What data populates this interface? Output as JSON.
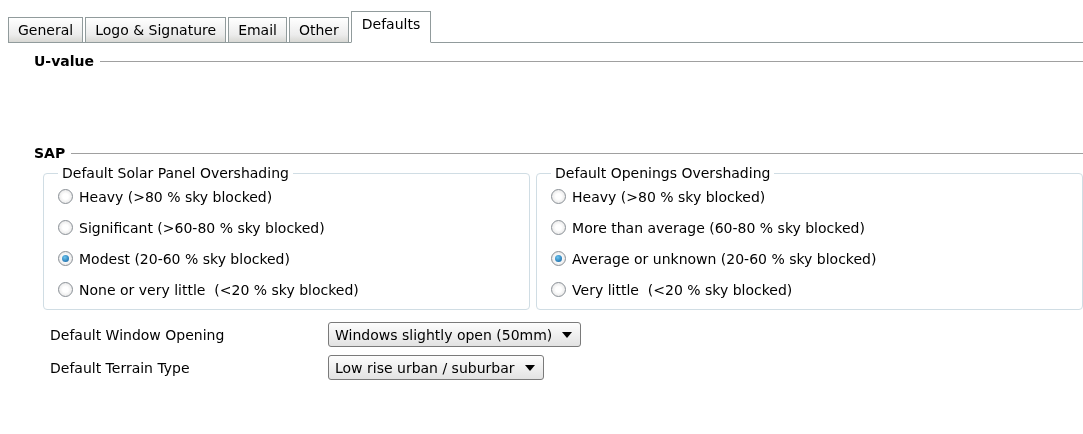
{
  "tabs": [
    {
      "label": "General",
      "selected": false
    },
    {
      "label": "Logo & Signature",
      "selected": false
    },
    {
      "label": "Email",
      "selected": false
    },
    {
      "label": "Other",
      "selected": false
    },
    {
      "label": "Defaults",
      "selected": true
    }
  ],
  "sections": [
    {
      "title": "U-value"
    },
    {
      "title": "SAP"
    }
  ],
  "groups": [
    {
      "title": "Default Solar Panel Overshading",
      "options": [
        {
          "label": "Heavy (>80 % sky blocked)",
          "selected": false
        },
        {
          "label": "Significant (>60-80 % sky blocked)",
          "selected": false
        },
        {
          "label": "Modest (20-60 % sky blocked)",
          "selected": true
        },
        {
          "label": "None or very little  (<20 % sky blocked)",
          "selected": false
        }
      ]
    },
    {
      "title": "Default Openings Overshading",
      "options": [
        {
          "label": "Heavy (>80 % sky blocked)",
          "selected": false
        },
        {
          "label": "More than average (60-80 % sky blocked)",
          "selected": false
        },
        {
          "label": "Average or unknown (20-60 % sky blocked)",
          "selected": true
        },
        {
          "label": "Very little  (<20 % sky blocked)",
          "selected": false
        }
      ]
    }
  ],
  "dropdowns": [
    {
      "label": "Default Window Opening",
      "value": "Windows slightly open (50mm)"
    },
    {
      "label": "Default Terrain Type",
      "value": "Low rise urban / suburbar"
    }
  ]
}
